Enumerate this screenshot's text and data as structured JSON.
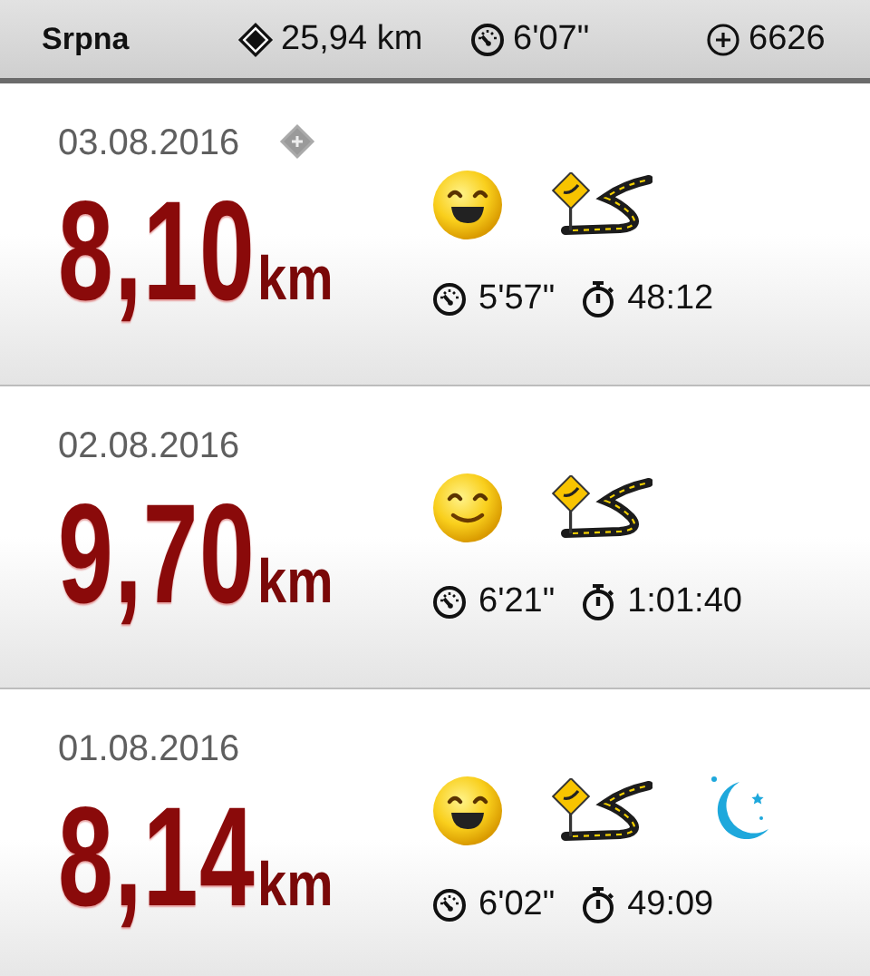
{
  "header": {
    "month": "Srpna",
    "total_distance": "25,94 km",
    "average_pace": "6'07\"",
    "total_points": "6626"
  },
  "runs": [
    {
      "date": "03.08.2016",
      "marked": true,
      "distance": "8,10",
      "unit": "km",
      "laughing": true,
      "night": false,
      "pace": "5'57\"",
      "duration": "48:12"
    },
    {
      "date": "02.08.2016",
      "marked": false,
      "distance": "9,70",
      "unit": "km",
      "laughing": false,
      "night": false,
      "pace": "6'21\"",
      "duration": "1:01:40"
    },
    {
      "date": "01.08.2016",
      "marked": false,
      "distance": "8,14",
      "unit": "km",
      "laughing": true,
      "night": true,
      "pace": "6'02\"",
      "duration": "49:09"
    }
  ]
}
